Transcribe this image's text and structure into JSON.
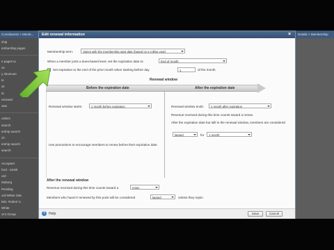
{
  "background": {
    "breadcrumb": "Constituents > Memb...",
    "breadcrumb_right": "Details > Membership",
    "sidebar_items": [
      "ship",
      "embership pages",
      "",
      "e pages to",
      "ze",
      "y shortcuts",
      "ts",
      "ck",
      "rk",
      "renewal",
      "ows",
      "",
      "orders",
      "search",
      "ership search",
      "ch",
      "ership search",
      "search",
      "",
      "Accepted",
      "ford - Smith",
      "ord",
      "Moberg",
      "Pending",
      "ord White Oak",
      "Mrs. Robert C.",
      "White",
      "or's Group"
    ]
  },
  "modal": {
    "title": "Edit renewal information",
    "membership_term_label": "Membership term:",
    "membership_term_value": "Varies with the membership start date (based on a rolling year)",
    "dues_label": "When a member joins a dues-based level, set the expiration date to:",
    "dues_value": "End of month",
    "set_expiration_label": "Set expiration to the end of the prior month when starting before day",
    "set_expiration_day": "1",
    "set_expiration_suffix": "of the month",
    "renewal_window_title": "Renewal window",
    "before_title": "Before the expiration date",
    "after_title": "After the expiration date",
    "window_starts_label": "Renewal window starts:",
    "window_starts_value": "1 month before expiration",
    "promotions_note": "Use promotions to encourage members to renew before their expiration date.",
    "window_ends_label": "Renewal window ends:",
    "window_ends_value": "1 month after expiration",
    "revenue_renewal_note": "Revenue received during this time counts toward a renew.",
    "after_lapsed_note": "After the expiration date but still in the renewal window, members are considered",
    "lapsed_value": "lapsed",
    "for_label": "for",
    "for_value": "1 month",
    "after_window_title": "After the renewal window",
    "rejoin_label": "Revenue received during this time counts toward a",
    "rejoin_value": "rejoin",
    "not_renewed_label": "Members who haven't renewed by this point will be considered",
    "not_renewed_value": "lapsed",
    "not_renewed_suffix": "unless they rejoin"
  },
  "footer": {
    "help_label": "Help",
    "save_label": "Save",
    "cancel_label": "Cancel"
  },
  "colors": {
    "title_bar": "#3f5f86",
    "annotation_arrow": "#7fcf3a"
  }
}
